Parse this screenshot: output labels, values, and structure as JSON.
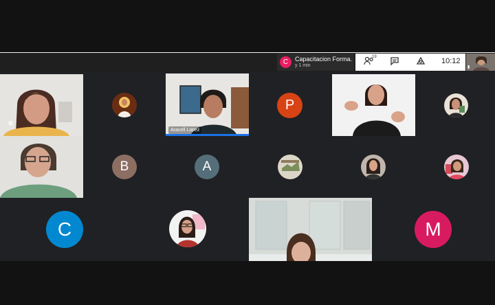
{
  "top_bar": {
    "meeting_avatar_letter": "C",
    "meeting_title": "Capacitacion Forma...",
    "meeting_duration": "y 1 min",
    "participants_count": "19",
    "clock": "10:12"
  },
  "participants": [
    {
      "type": "video",
      "name": ""
    },
    {
      "type": "avatar_picture",
      "name": ""
    },
    {
      "type": "video",
      "name": "Aracell Lopez"
    },
    {
      "type": "avatar_letter",
      "letter": "P",
      "color": "#d84315"
    },
    {
      "type": "video",
      "name": ""
    },
    {
      "type": "avatar_picture",
      "name": ""
    },
    {
      "type": "video",
      "name": ""
    },
    {
      "type": "avatar_letter",
      "letter": "B",
      "color": "#8d6e63"
    },
    {
      "type": "avatar_letter",
      "letter": "A",
      "color": "#546e7a"
    },
    {
      "type": "avatar_picture",
      "name": ""
    },
    {
      "type": "avatar_picture",
      "name": ""
    },
    {
      "type": "avatar_picture",
      "name": ""
    },
    {
      "type": "avatar_letter",
      "letter": "C",
      "color": "#0288d1"
    },
    {
      "type": "avatar_picture",
      "name": ""
    },
    {
      "type": "video",
      "name": ""
    },
    {
      "type": "avatar_letter",
      "letter": "M",
      "color": "#d81b60"
    }
  ],
  "colors": {
    "active_speaker_border": "#1a73e8",
    "background": "#202124"
  }
}
